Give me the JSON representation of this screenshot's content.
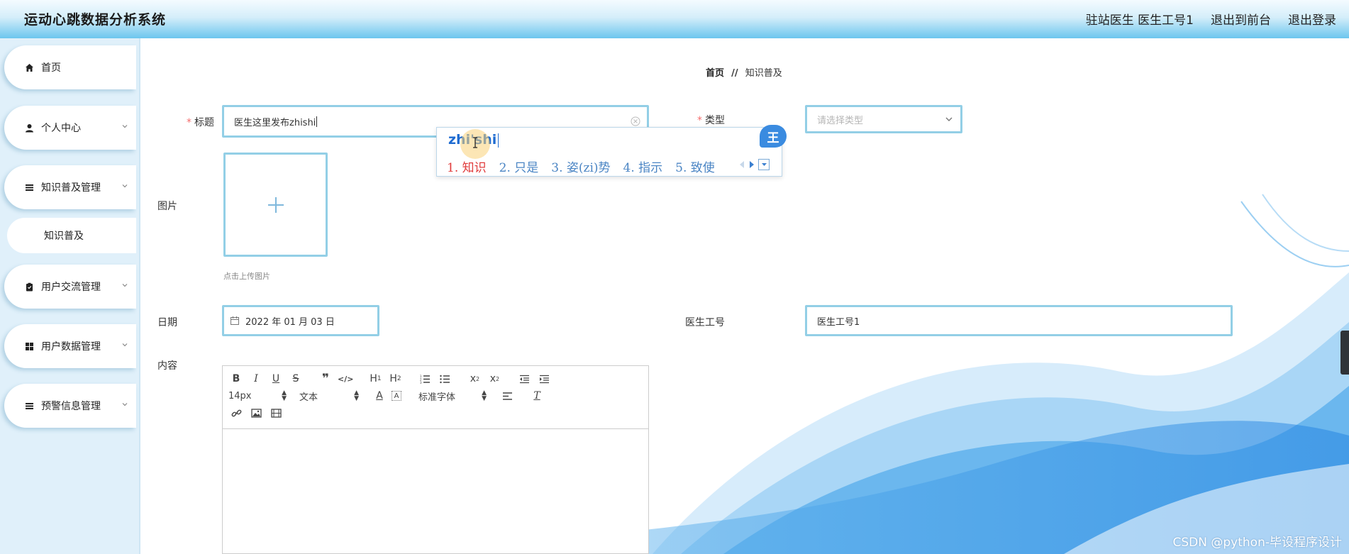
{
  "header": {
    "title": "运动心跳数据分析系统",
    "user_label": "驻站医生 医生工号1",
    "to_frontend": "退出到前台",
    "logout": "退出登录"
  },
  "sidebar": {
    "items": [
      {
        "label": "首页",
        "icon": "home-icon"
      },
      {
        "label": "个人中心",
        "icon": "user-icon"
      },
      {
        "label": "知识普及管理",
        "icon": "list-icon"
      },
      {
        "label": "知识普及",
        "icon": ""
      },
      {
        "label": "用户交流管理",
        "icon": "clipboard-icon"
      },
      {
        "label": "用户数据管理",
        "icon": "grid-icon"
      },
      {
        "label": "预警信息管理",
        "icon": "list-icon"
      }
    ]
  },
  "breadcrumb": {
    "home": "首页",
    "separator": "//",
    "current": "知识普及"
  },
  "form": {
    "title_label": "标题",
    "title_value": "医生这里发布zhishi",
    "type_label": "类型",
    "type_placeholder": "请选择类型",
    "image_label": "图片",
    "upload_hint": "点击上传图片",
    "date_label": "日期",
    "date_value": "2022 年 01 月 03 日",
    "doctor_id_label": "医生工号",
    "doctor_id_value": "医生工号1",
    "content_label": "内容"
  },
  "ime": {
    "pinyin": "zhi'shi",
    "candidates": [
      "1. 知识",
      "2. 只是",
      "3. 姿(zi)势",
      "4. 指示",
      "5. 致使"
    ],
    "logo": "王"
  },
  "editor": {
    "font_size": "14px",
    "text_style": "文本",
    "font_family": "标准字体"
  },
  "watermark": "CSDN @python-毕设程序设计",
  "colors": {
    "accent": "#93cfe6",
    "required": "#f56c6c",
    "ime_blue": "#1e6bd1",
    "ime_red": "#e03c3c"
  }
}
